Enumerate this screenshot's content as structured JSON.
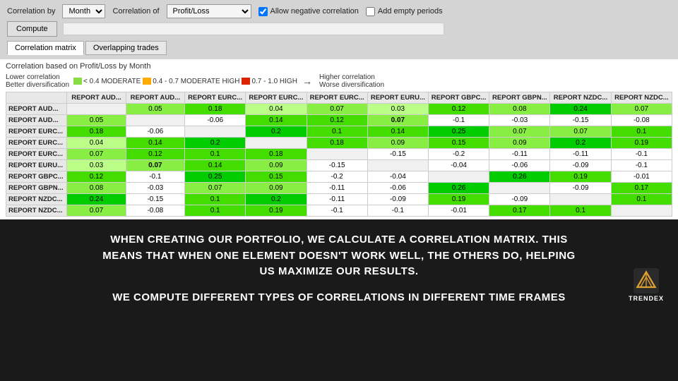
{
  "controls": {
    "correlation_by_label": "Correlation by",
    "correlation_by_value": "Month",
    "correlation_of_label": "Correlation of",
    "correlation_of_value": "Profit/Loss",
    "allow_negative_label": "Allow negative correlation",
    "add_empty_label": "Add empty periods",
    "compute_label": "Compute"
  },
  "tabs": [
    {
      "id": "matrix",
      "label": "Correlation matrix",
      "active": true
    },
    {
      "id": "overlapping",
      "label": "Overlapping trades",
      "active": false
    }
  ],
  "matrix": {
    "basis_label": "Correlation based on Profit/Loss by Month",
    "legend": {
      "lower_label": "Lower correlation",
      "better_label": "Better diversification",
      "higher_label": "Higher correlation",
      "worse_label": "Worse diversification",
      "items": [
        {
          "color": "#88dd44",
          "label": "< 0.4 MODERATE"
        },
        {
          "color": "#ffaa00",
          "label": "0.4 - 0.7 MODERATE HIGH"
        },
        {
          "color": "#dd2200",
          "label": "0.7 - 1.0 HIGH"
        }
      ]
    },
    "columns": [
      "REPORT AUD...",
      "REPORT AUD...",
      "REPORT EURC...",
      "REPORT EURC...",
      "REPORT EURC...",
      "REPORT EURU...",
      "REPORT GBPC...",
      "REPORT GBPN...",
      "REPORT NZDC...",
      "REPORT NZDC..."
    ],
    "rows": [
      {
        "label": "REPORT AUD...",
        "cells": [
          "",
          "0.05",
          "0.18",
          "0.04",
          "0.07",
          "0.03",
          "0.12",
          "0.08",
          "0.24",
          "0.07"
        ]
      },
      {
        "label": "REPORT AUD...",
        "cells": [
          "0.05",
          "",
          "-0.06",
          "0.14",
          "0.12",
          "0.07",
          "-0.1",
          "-0.03",
          "-0.15",
          "-0.08"
        ]
      },
      {
        "label": "REPORT EURC...",
        "cells": [
          "0.18",
          "-0.06",
          "",
          "0.2",
          "0.1",
          "0.14",
          "0.25",
          "0.07",
          "0.07",
          "0.1"
        ]
      },
      {
        "label": "REPORT EURC...",
        "cells": [
          "0.04",
          "0.14",
          "0.2",
          "",
          "0.18",
          "0.09",
          "0.15",
          "0.09",
          "0.2",
          "0.19"
        ]
      },
      {
        "label": "REPORT EURC...",
        "cells": [
          "0.07",
          "0.12",
          "0.1",
          "0.18",
          "",
          "-0.15",
          "-0.2",
          "-0.11",
          "-0.11",
          "-0.1"
        ]
      },
      {
        "label": "REPORT EURU...",
        "cells": [
          "0.03",
          "0.07",
          "0.14",
          "0.09",
          "-0.15",
          "",
          "-0.04",
          "-0.06",
          "-0.09",
          "-0.1"
        ]
      },
      {
        "label": "REPORT GBPC...",
        "cells": [
          "0.12",
          "-0.1",
          "0.25",
          "0.15",
          "-0.2",
          "-0.04",
          "",
          "0.26",
          "0.19",
          "-0.01"
        ]
      },
      {
        "label": "REPORT GBPN...",
        "cells": [
          "0.08",
          "-0.03",
          "0.07",
          "0.09",
          "-0.11",
          "-0.06",
          "0.26",
          "",
          "-0.09",
          "0.17"
        ]
      },
      {
        "label": "REPORT NZDC...",
        "cells": [
          "0.24",
          "-0.15",
          "0.1",
          "0.2",
          "-0.11",
          "-0.09",
          "0.19",
          "-0.09",
          "",
          "0.1"
        ]
      },
      {
        "label": "REPORT NZDC...",
        "cells": [
          "0.07",
          "-0.08",
          "0.1",
          "0.19",
          "-0.1",
          "-0.1",
          "-0.01",
          "0.17",
          "0.1",
          ""
        ]
      }
    ]
  },
  "bottom": {
    "text1": "WHEN CREATING OUR PORTFOLIO, WE CALCULATE A CORRELATION MATRIX. THIS\nMEANS THAT WHEN ONE ELEMENT DOESN'T WORK WELL, THE OTHERS DO, HELPING\nUS MAXIMIZE OUR RESULTS.",
    "text2": "WE COMPUTE DIFFERENT TYPES OF CORRELATIONS IN DIFFERENT TIME FRAMES",
    "logo_label": "TRENDEX"
  }
}
